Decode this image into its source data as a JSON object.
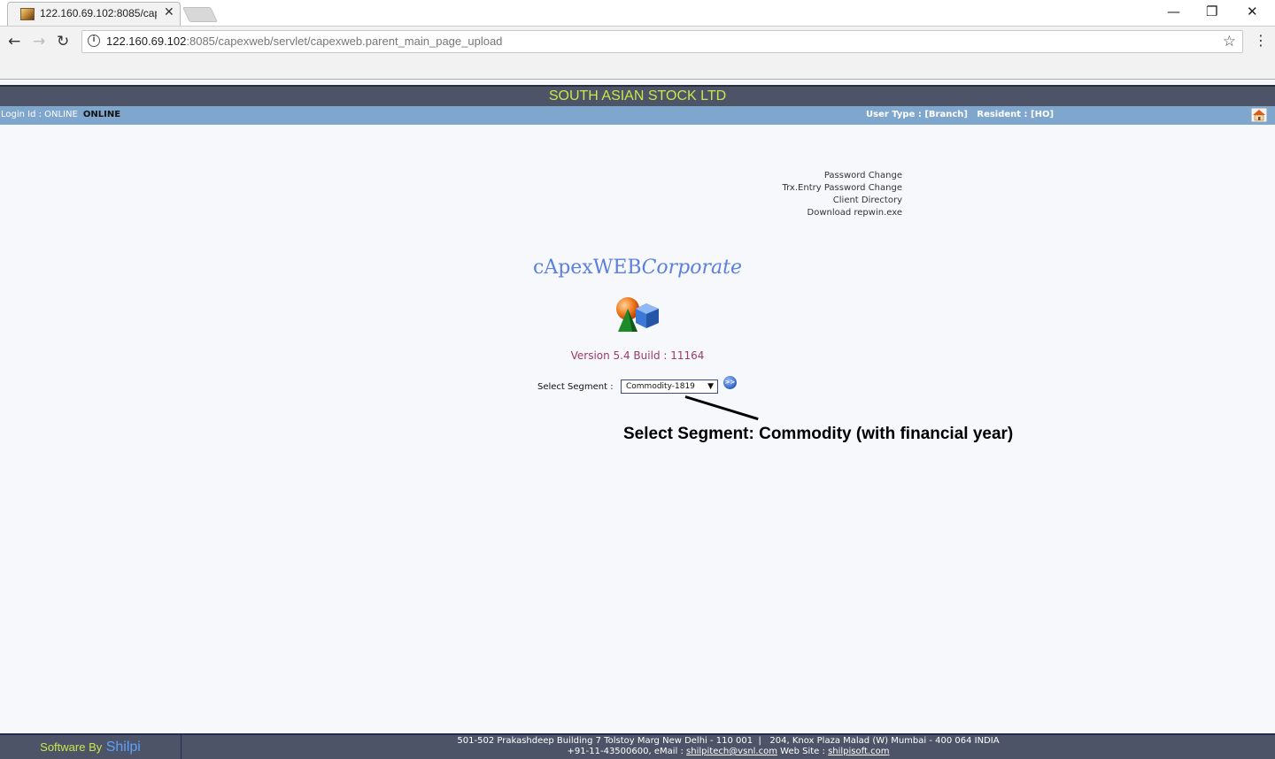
{
  "browser": {
    "tab_title": "122.160.69.102:8085/cap",
    "url_host": "122.160.69.102",
    "url_path": ":8085/capexweb/servlet/capexweb.parent_main_page_upload"
  },
  "header": {
    "company": "SOUTH ASIAN STOCK LTD"
  },
  "userbar": {
    "login_label": "Login Id : ONLINE",
    "login_value": "ONLINE",
    "user_type": "User Type : [Branch]   Resident : [HO]"
  },
  "links": [
    "Password Change",
    "Trx.Entry Password Change",
    "Client Directory",
    "Download repwin.exe"
  ],
  "brand": {
    "name": "cApexWEB",
    "suffix": "Corporate"
  },
  "version": "Version 5.4 Build : 11164",
  "segment": {
    "label": "Select Segment :",
    "selected": "Commodity-1819"
  },
  "annotation": "Select Segment: Commodity (with financial year)",
  "footer": {
    "software_by": "Software By",
    "vendor": "Shilpi",
    "address_line1": "501-502 Prakashdeep Building 7 Tolstoy Marg New Delhi - 110 001  |   204, Knox Plaza Malad (W) Mumbai - 400 064 INDIA",
    "phone_email_label": "+91-11-43500600, eMail :",
    "email": "shilpitech@vsnl.com",
    "website_label": "Web Site :",
    "website": "shilpisoft.com"
  }
}
